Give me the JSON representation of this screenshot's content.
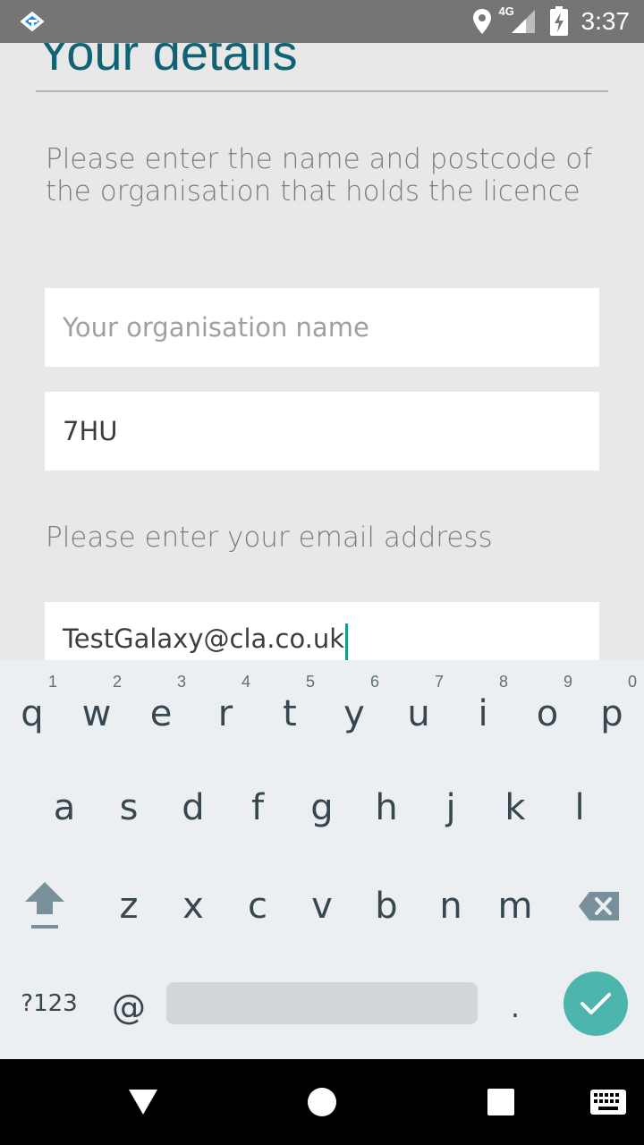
{
  "status_bar": {
    "network": "4G",
    "time": "3:37",
    "icons": [
      "app-notification-icon",
      "location-icon",
      "signal-icon",
      "battery-charging-icon"
    ]
  },
  "page": {
    "title": "Your details",
    "organisation_prompt": "Please enter the name and postcode of the organisation that holds the licence",
    "organisation_name": {
      "placeholder": "Your organisation name",
      "value": ""
    },
    "postcode": {
      "value": "7HU"
    },
    "email_prompt": "Please enter your email address",
    "email": {
      "value": "TestGalaxy@cla.co.uk"
    },
    "accent_color": "#0f6374",
    "cursor_color": "#199a8b"
  },
  "keyboard": {
    "row1": [
      {
        "key": "q",
        "hint": "1"
      },
      {
        "key": "w",
        "hint": "2"
      },
      {
        "key": "e",
        "hint": "3"
      },
      {
        "key": "r",
        "hint": "4"
      },
      {
        "key": "t",
        "hint": "5"
      },
      {
        "key": "y",
        "hint": "6"
      },
      {
        "key": "u",
        "hint": "7"
      },
      {
        "key": "i",
        "hint": "8"
      },
      {
        "key": "o",
        "hint": "9"
      },
      {
        "key": "p",
        "hint": "0"
      }
    ],
    "row2": [
      "a",
      "s",
      "d",
      "f",
      "g",
      "h",
      "j",
      "k",
      "l"
    ],
    "row3": [
      "z",
      "x",
      "c",
      "v",
      "b",
      "n",
      "m"
    ],
    "symbols_label": "?123",
    "at_label": "@",
    "period_label": ".",
    "enter_color": "#4db6ac",
    "icons": [
      "shift-icon",
      "backspace-icon",
      "enter-check-icon"
    ]
  },
  "nav_bar": {
    "icons": [
      "back-icon",
      "home-icon",
      "recents-icon",
      "keyboard-switch-icon"
    ]
  }
}
